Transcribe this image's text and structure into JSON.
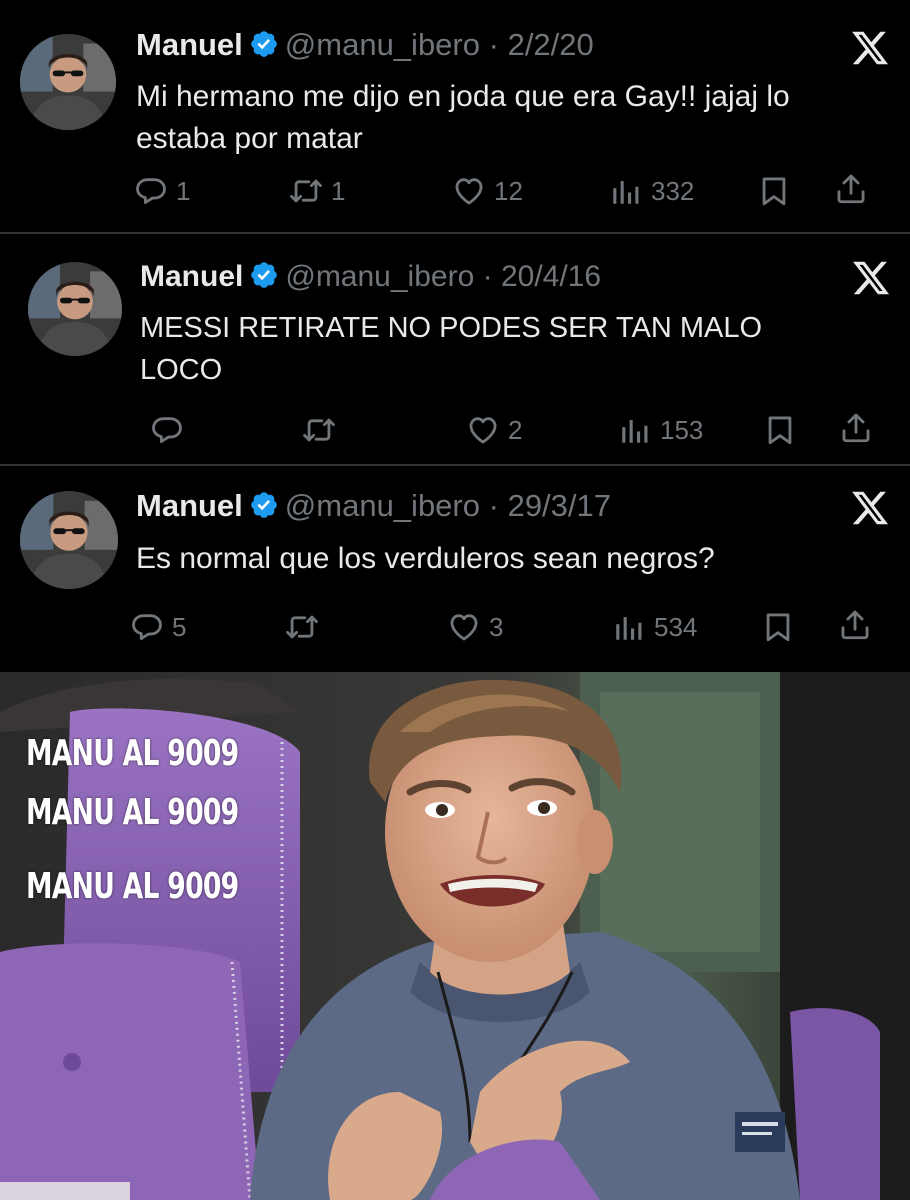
{
  "tweets": [
    {
      "name": "Manuel",
      "handle": "@manu_ibero",
      "separator": "·",
      "date": "2/2/20",
      "text": "Mi hermano me dijo en joda que era Gay!! jajaj lo estaba por matar",
      "replies": "1",
      "retweets": "1",
      "likes": "12",
      "views": "332"
    },
    {
      "name": "Manuel",
      "handle": "@manu_ibero",
      "separator": "·",
      "date": "20/4/16",
      "text": "MESSI RETIRATE NO PODES SER TAN MALO LOCO",
      "replies": "",
      "retweets": "",
      "likes": "2",
      "views": "153"
    },
    {
      "name": "Manuel",
      "handle": "@manu_ibero",
      "separator": "·",
      "date": "29/3/17",
      "text": "Es normal que los verduleros sean negros?",
      "replies": "5",
      "retweets": "",
      "likes": "3",
      "views": "534"
    }
  ],
  "meme": {
    "caption_lines": [
      "MANU AL 9009",
      "MANU AL 9009",
      "MANU AL 9009"
    ]
  },
  "icons": {
    "verified": "verified-badge-icon",
    "platform": "x-logo-icon",
    "reply": "reply-icon",
    "retweet": "retweet-icon",
    "like": "heart-icon",
    "views": "views-icon",
    "bookmark": "bookmark-icon",
    "share": "share-icon"
  },
  "colors": {
    "background": "#000000",
    "text": "#e7e9ea",
    "muted": "#71767b",
    "verified": "#1d9bf0",
    "chair_purple": "#8a62b0"
  }
}
